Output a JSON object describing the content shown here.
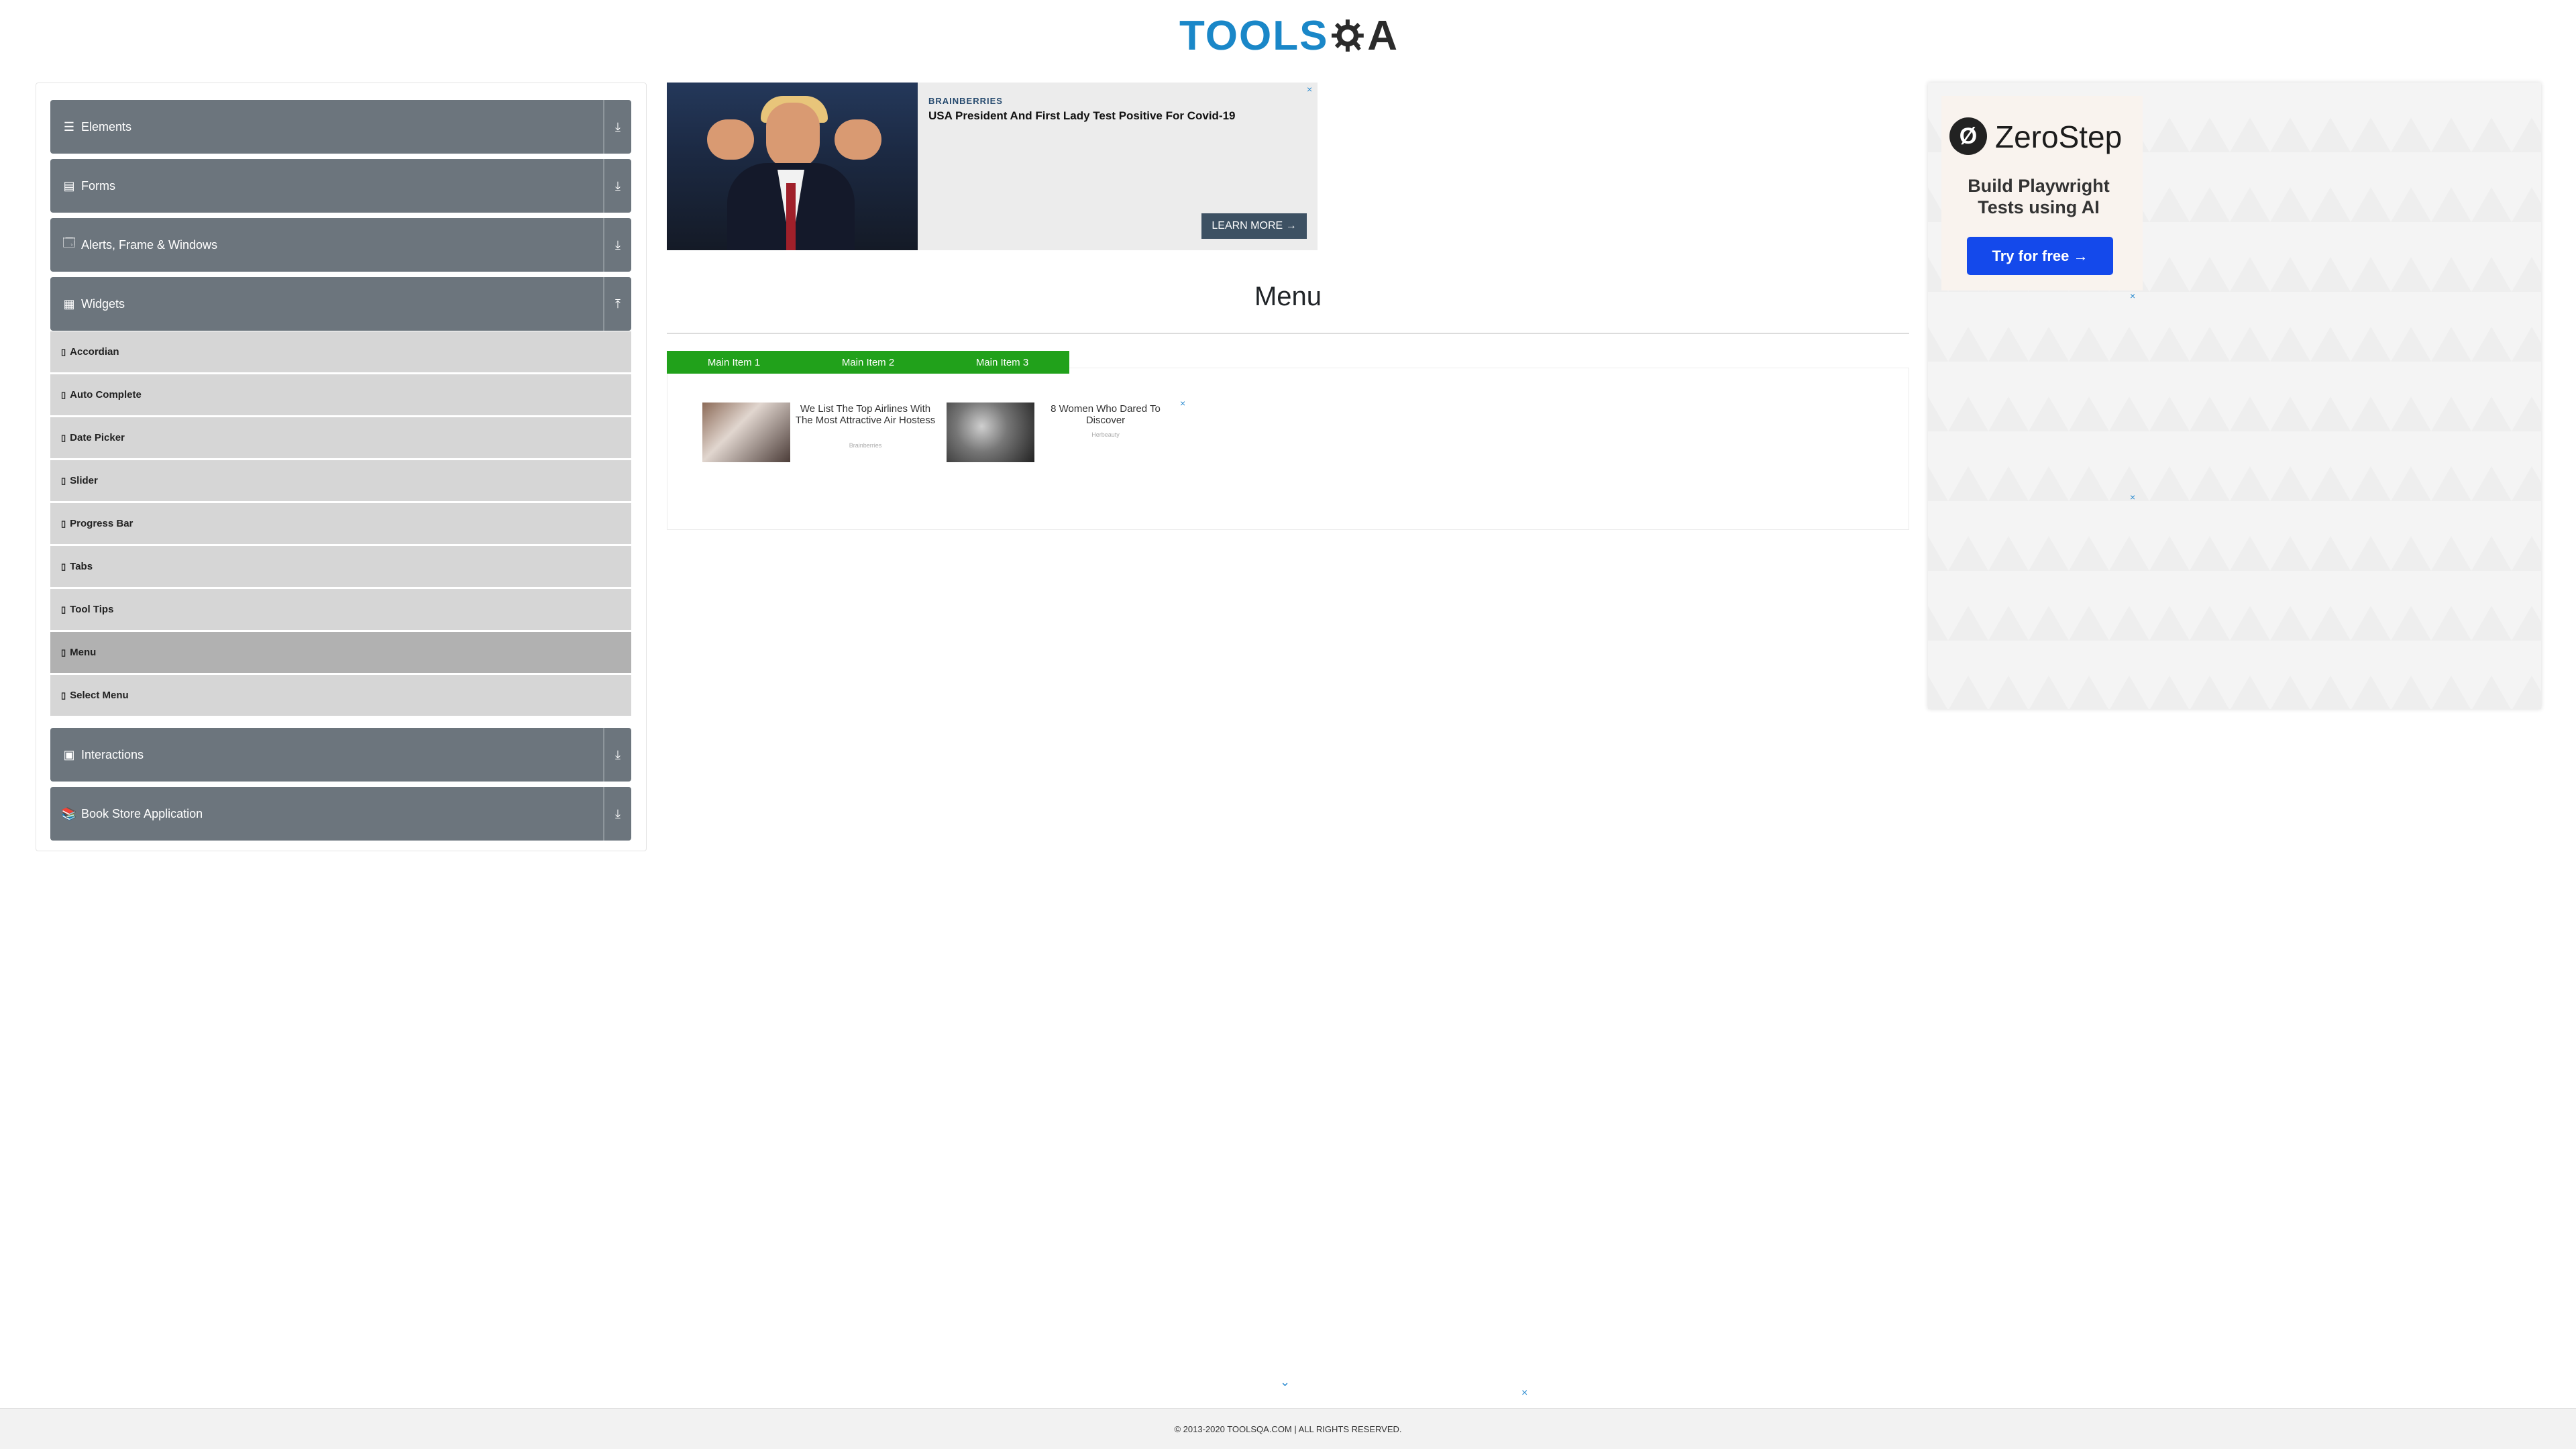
{
  "header": {
    "logo_text": "TOOLS",
    "logo_suffix": "A",
    "logo_name": "TOOLSQA"
  },
  "sidebar": {
    "groups": [
      {
        "label": "Elements",
        "icon": "list-icon",
        "glyph": "☰",
        "toggle": "⤓"
      },
      {
        "label": "Forms",
        "icon": "form-icon",
        "glyph": "▤",
        "toggle": "⤓"
      },
      {
        "label": "Alerts, Frame & Windows",
        "icon": "window-icon",
        "glyph": "🗔",
        "toggle": "⤓"
      },
      {
        "label": "Widgets",
        "icon": "grid-icon",
        "glyph": "▦",
        "toggle": "⤒"
      },
      {
        "label": "Interactions",
        "icon": "interactions-icon",
        "glyph": "▣",
        "toggle": "⤓"
      },
      {
        "label": "Book Store Application",
        "icon": "book-icon",
        "glyph": "📚",
        "toggle": "⤓"
      }
    ],
    "items": [
      {
        "label": "Accordian"
      },
      {
        "label": "Auto Complete"
      },
      {
        "label": "Date Picker"
      },
      {
        "label": "Slider"
      },
      {
        "label": "Progress Bar"
      },
      {
        "label": "Tabs"
      },
      {
        "label": "Tool Tips"
      },
      {
        "label": "Menu"
      },
      {
        "label": "Select Menu"
      }
    ],
    "item_glyph": "▯"
  },
  "ad_top": {
    "brand": "BRAINBERRIES",
    "headline": "USA President And First Lady Test Positive For Covid-19",
    "cta": "LEARN MORE →",
    "close": "×"
  },
  "main": {
    "title": "Menu",
    "menu_items": [
      "Main Item 1",
      "Main Item 2",
      "Main Item 3"
    ],
    "cards": [
      {
        "title": "We List The Top Airlines With The Most Attractive Air Hostess",
        "source": "Brainberries"
      },
      {
        "title": "8 Women Who Dared To Discover",
        "source": "Herbeauty"
      }
    ],
    "close": "×"
  },
  "ad_right": {
    "logo_glyph": "Ø",
    "brand": "ZeroStep",
    "tagline": "Build Playwright Tests using AI",
    "button": "Try for free →",
    "close": "×"
  },
  "bottom": {
    "chevron": "⌄",
    "close": "×"
  },
  "footer": {
    "text": "© 2013-2020 TOOLSQA.COM | ALL RIGHTS RESERVED."
  },
  "colors": {
    "group_bg": "#6c757d",
    "item_bg": "#d6d6d6",
    "item_active": "#b1b1b1",
    "menu_green": "#21a11b",
    "logo_blue": "#1a87c8",
    "cta_blue": "#1449eb"
  }
}
